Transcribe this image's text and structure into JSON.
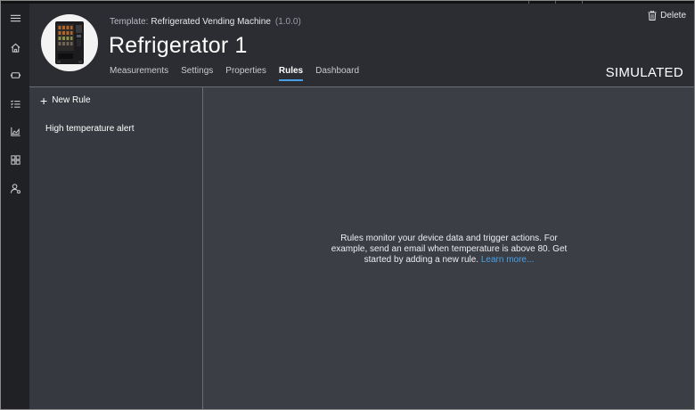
{
  "nav": {
    "items": [
      {
        "name": "menu",
        "icon": "hamburger-menu-icon"
      },
      {
        "name": "home",
        "icon": "home-icon"
      },
      {
        "name": "devices",
        "icon": "device-icon"
      },
      {
        "name": "rules",
        "icon": "list-check-icon"
      },
      {
        "name": "analytics",
        "icon": "analytics-chart-icon"
      },
      {
        "name": "dashboards",
        "icon": "grid-icon"
      },
      {
        "name": "users",
        "icon": "user-settings-icon"
      }
    ]
  },
  "header": {
    "template_label": "Template:",
    "template_name": "Refrigerated Vending Machine",
    "template_version": "(1.0.0)",
    "device_name": "Refrigerator 1",
    "status": "SIMULATED",
    "delete_label": "Delete",
    "tabs": [
      {
        "label": "Measurements"
      },
      {
        "label": "Settings"
      },
      {
        "label": "Properties"
      },
      {
        "label": "Rules",
        "active": true
      },
      {
        "label": "Dashboard"
      }
    ]
  },
  "rules_panel": {
    "new_rule_label": "New Rule",
    "rules": [
      {
        "label": "High temperature alert"
      }
    ]
  },
  "empty_state": {
    "message": "Rules monitor your device data and trigger actions. For example, send an email when temperature is above 80. Get started by adding a new rule.",
    "link_text": "Learn more..."
  },
  "colors": {
    "accent": "#4aa0e6",
    "rail_bg": "#1f2125",
    "header_bg": "#2b2d33",
    "content_bg": "#3b3e45"
  }
}
